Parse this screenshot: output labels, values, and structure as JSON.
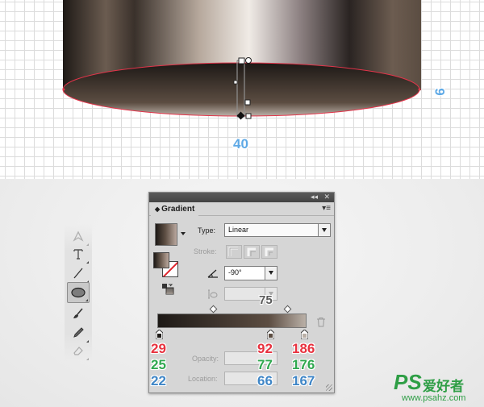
{
  "canvas": {
    "width_label": "40",
    "height_label": "9"
  },
  "tools_panel": {
    "tools": [
      {
        "name": "pen-icon",
        "active": false
      },
      {
        "name": "type-icon",
        "active": false
      },
      {
        "name": "line-icon",
        "active": false
      },
      {
        "name": "ellipse-icon",
        "active": true
      },
      {
        "name": "brush-icon",
        "active": false
      },
      {
        "name": "pencil-icon",
        "active": false
      },
      {
        "name": "eraser-icon",
        "active": false
      }
    ]
  },
  "gradient_panel": {
    "title": "Gradient",
    "type_label": "Type:",
    "type_value": "Linear",
    "stroke_label": "Stroke:",
    "angle_value": "-90°",
    "ramp_annotation": "75",
    "opacity_label": "Opacity:",
    "location_label": "Location:",
    "stops": [
      {
        "color": "#1d1916",
        "location": 0
      },
      {
        "color": "#5c4d42",
        "location": 75
      },
      {
        "color": "#bab0a7",
        "location": 100
      }
    ]
  },
  "color_stops": [
    {
      "r": "29",
      "g": "25",
      "b": "22"
    },
    {
      "r": "92",
      "g": "77",
      "b": "66"
    },
    {
      "r": "186",
      "g": "176",
      "b": "167"
    }
  ],
  "watermark": {
    "logo": "PS",
    "text": "爱好者",
    "url": "www.psahz.com"
  }
}
